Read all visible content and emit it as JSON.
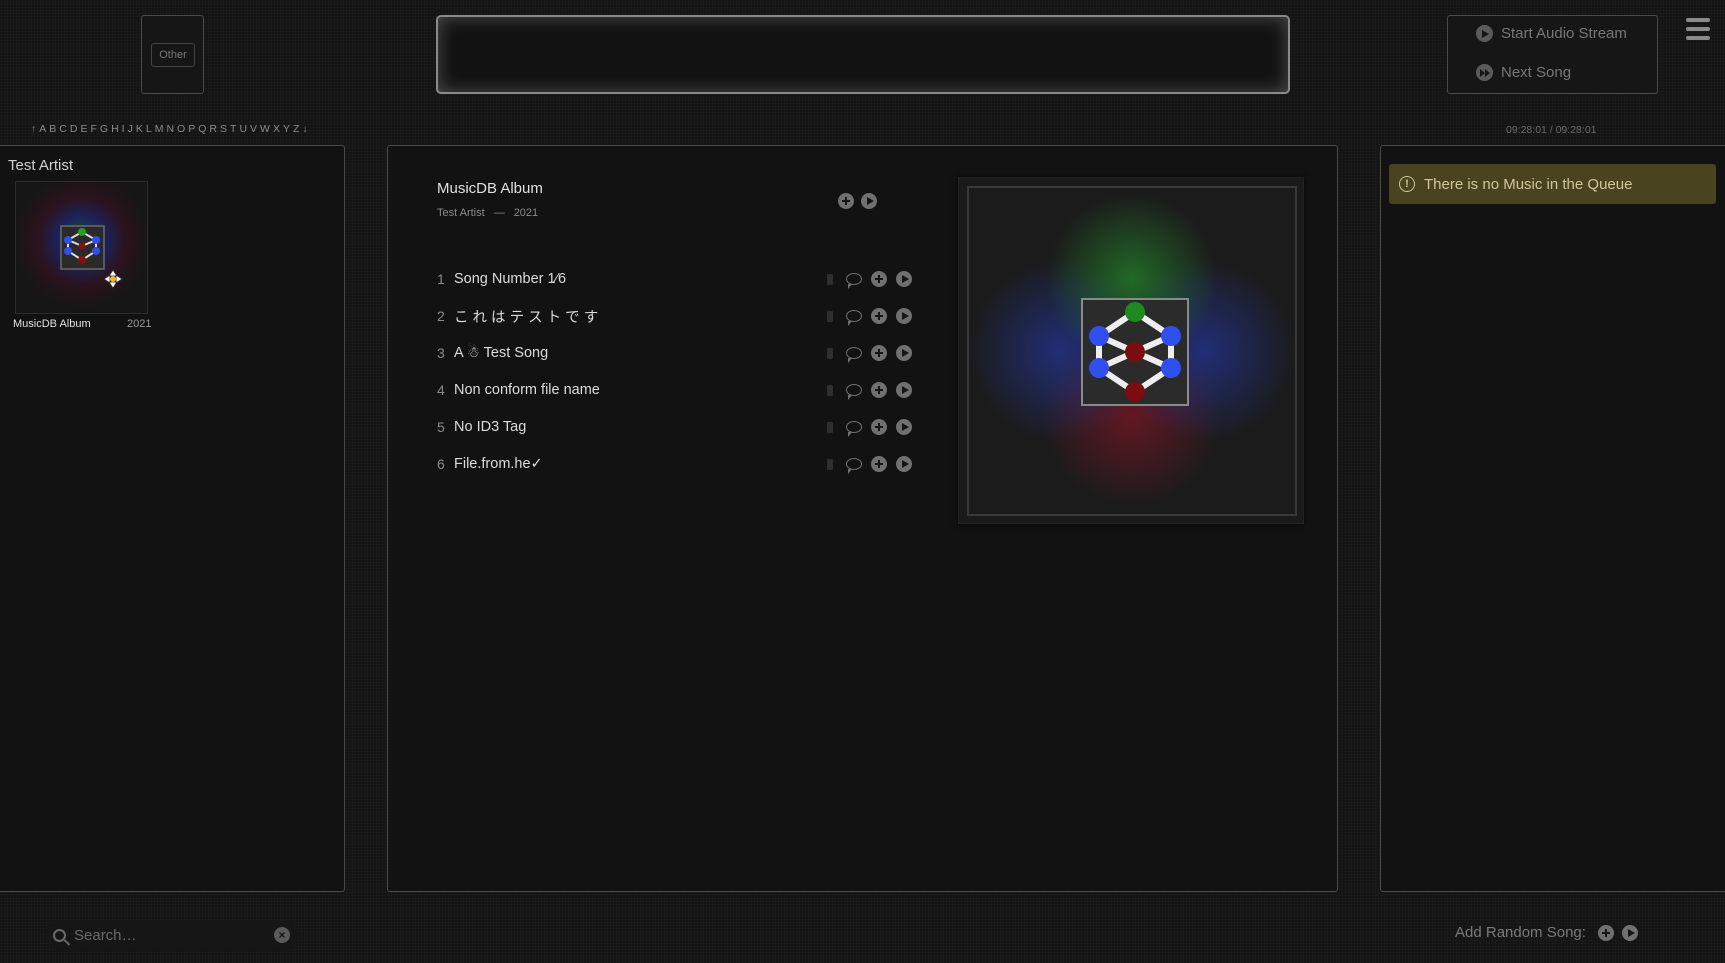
{
  "genre": {
    "button_label": "Other"
  },
  "stream": {
    "start_label": "Start Audio Stream",
    "next_label": "Next Song"
  },
  "alphabet": [
    "↑",
    "A",
    "B",
    "C",
    "D",
    "E",
    "F",
    "G",
    "H",
    "I",
    "J",
    "K",
    "L",
    "M",
    "N",
    "O",
    "P",
    "Q",
    "R",
    "S",
    "T",
    "U",
    "V",
    "W",
    "X",
    "Y",
    "Z",
    "↓"
  ],
  "clock": "09:28:01 / 09:28:01",
  "artists": {
    "artist_name": "Test Artist",
    "album_name": "MusicDB Album",
    "album_year": "2021"
  },
  "album": {
    "title": "MusicDB Album",
    "artist": "Test Artist",
    "separator": "—",
    "year": "2021",
    "songs": [
      {
        "number": "1",
        "title": "Song Number 1⁄6"
      },
      {
        "number": "2",
        "title": "こ れ は テ ス ト で す"
      },
      {
        "number": "3",
        "title": "A ☃ Test Song"
      },
      {
        "number": "4",
        "title": "Non conform file name"
      },
      {
        "number": "5",
        "title": "No ID3 Tag"
      },
      {
        "number": "6",
        "title": "File.from.he✓"
      }
    ]
  },
  "queue": {
    "empty_message": "There is no Music in the Queue"
  },
  "search": {
    "placeholder": "Search…"
  },
  "footer": {
    "random_label": "Add Random Song:"
  },
  "colors": {
    "background": "#141414",
    "queue_notice_bg": "#4a4320",
    "icon_gray": "#707070"
  }
}
